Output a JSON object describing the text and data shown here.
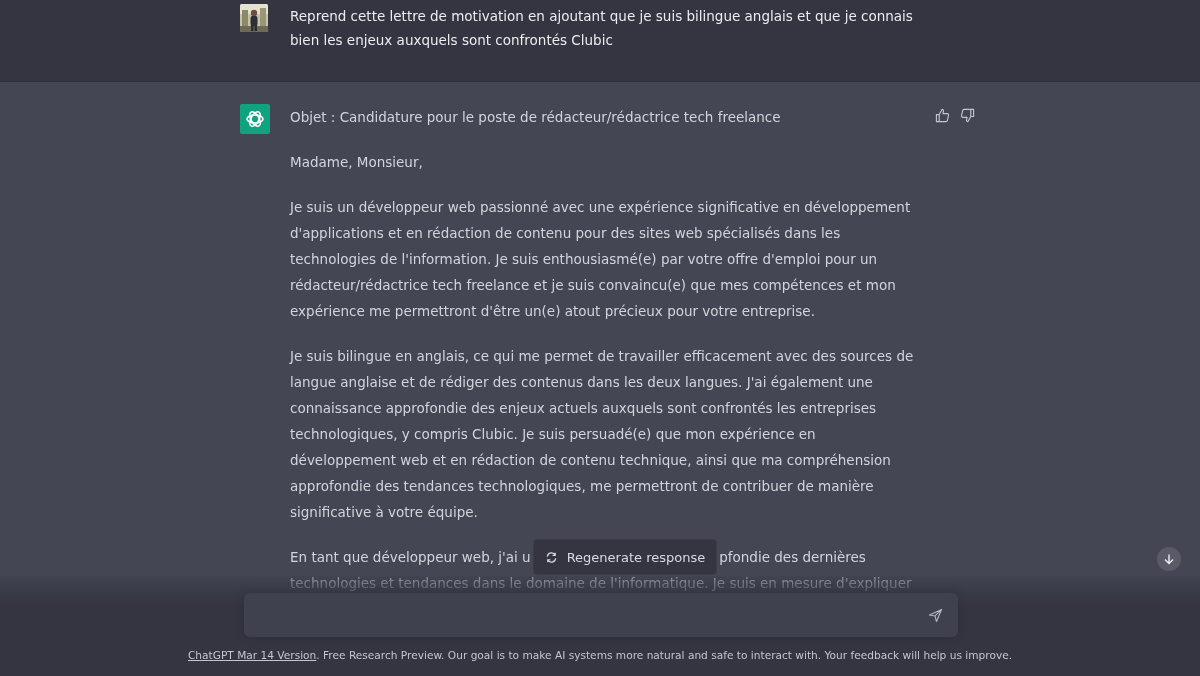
{
  "user_message": {
    "lines": [
      "Reprend cette lettre de motivation en ajoutant que je suis bilingue anglais et que je connais",
      "bien les enjeux auxquels sont confrontés Clubic"
    ]
  },
  "assistant_message": {
    "paragraphs": [
      {
        "lines": [
          "Objet : Candidature pour le poste de rédacteur/rédactrice tech freelance"
        ]
      },
      {
        "lines": [
          "Madame, Monsieur,"
        ]
      },
      {
        "lines": [
          "Je suis un développeur web passionné avec une expérience significative en développement",
          "d'applications et en rédaction de contenu pour des sites web spécialisés dans les",
          "technologies de l'information. Je suis enthousiasmé(e) par votre offre d'emploi pour un",
          "rédacteur/rédactrice tech freelance et je suis convaincu(e) que mes compétences et mon",
          "expérience me permettront d'être un(e) atout précieux pour votre entreprise."
        ]
      },
      {
        "lines": [
          "Je suis bilingue en anglais, ce qui me permet de travailler efficacement avec des sources de",
          "langue anglaise et de rédiger des contenus dans les deux langues. J'ai également une",
          "connaissance approfondie des enjeux actuels auxquels sont confrontés les entreprises",
          "technologiques, y compris Clubic. Je suis persuadé(e) que mon expérience en",
          "développement web et en rédaction de contenu technique, ainsi que ma compréhension",
          "approfondie des tendances technologiques, me permettront de contribuer de manière",
          "significative à votre équipe."
        ]
      }
    ],
    "partial_paragraph": {
      "before": "En tant que développeur web, j'ai u",
      "after": "pfondie des dernières",
      "next_line": "technologies et tendances dans le domaine de l'informatique. Je suis en mesure d'expliquer"
    }
  },
  "regenerate_button": {
    "label": "Regenerate response"
  },
  "footer": {
    "link": "ChatGPT Mar 14 Version",
    "text": ". Free Research Preview. Our goal is to make AI systems more natural and safe to interact with. Your feedback will help us improve."
  }
}
